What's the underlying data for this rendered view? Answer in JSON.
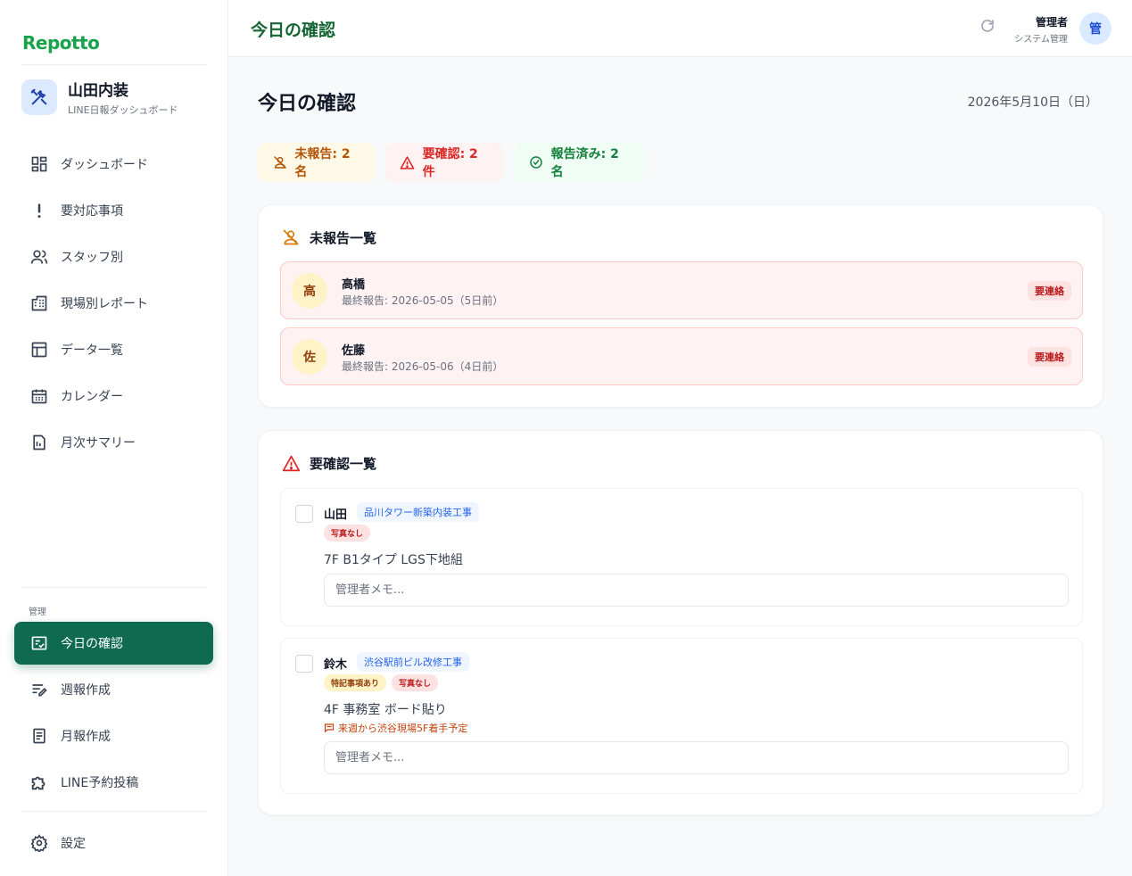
{
  "app": {
    "brand": "Repotto"
  },
  "company": {
    "name": "山田内装",
    "subtitle": "LINE日報ダッシュボード"
  },
  "sidebar": {
    "items": [
      {
        "label": "ダッシュボード",
        "icon": "dashboard-icon"
      },
      {
        "label": "要対応事項",
        "icon": "exclamation-icon"
      },
      {
        "label": "スタッフ別",
        "icon": "users-icon"
      },
      {
        "label": "現場別レポート",
        "icon": "building-icon"
      },
      {
        "label": "データ一覧",
        "icon": "table-icon"
      },
      {
        "label": "カレンダー",
        "icon": "calendar-icon"
      },
      {
        "label": "月次サマリー",
        "icon": "document-icon"
      }
    ],
    "section_label": "管理",
    "admin_items": [
      {
        "label": "今日の確認",
        "icon": "checklist-icon",
        "active": true
      },
      {
        "label": "週報作成",
        "icon": "edit-list-icon"
      },
      {
        "label": "月報作成",
        "icon": "report-icon"
      },
      {
        "label": "LINE予約投稿",
        "icon": "puzzle-icon"
      }
    ],
    "settings_label": "設定"
  },
  "header": {
    "title": "今日の確認",
    "user_name": "管理者",
    "user_role": "システム管理",
    "avatar_initial": "管"
  },
  "main": {
    "title": "今日の確認",
    "date": "2026年5月10日（日）",
    "stats": {
      "unreported": "未報告: 2名",
      "needs_check": "要確認: 2件",
      "reported": "報告済み: 2名"
    },
    "unreported_section": {
      "title": "未報告一覧",
      "rows": [
        {
          "initial": "高",
          "name": "高橋",
          "last_report": "最終報告: 2026-05-05（5日前）",
          "badge": "要連絡"
        },
        {
          "initial": "佐",
          "name": "佐藤",
          "last_report": "最終報告: 2026-05-06（4日前）",
          "badge": "要連絡"
        }
      ]
    },
    "check_section": {
      "title": "要確認一覧",
      "items": [
        {
          "name": "山田",
          "site": "品川タワー新築内装工事",
          "tags": [
            "写真なし"
          ],
          "description": "7F B1タイプ LGS下地組",
          "memo_placeholder": "管理者メモ..."
        },
        {
          "name": "鈴木",
          "site": "渋谷駅前ビル改修工事",
          "tags": [
            "特記事項あり",
            "写真なし"
          ],
          "description": "4F 事務室 ボード貼り",
          "note": "来週から渋谷現場5F着手予定",
          "memo_placeholder": "管理者メモ..."
        }
      ]
    }
  },
  "colors": {
    "brand": "#16a34a",
    "active_nav": "#0f6b4e",
    "warning": "#b45309",
    "danger": "#dc2626",
    "success": "#15803d"
  }
}
